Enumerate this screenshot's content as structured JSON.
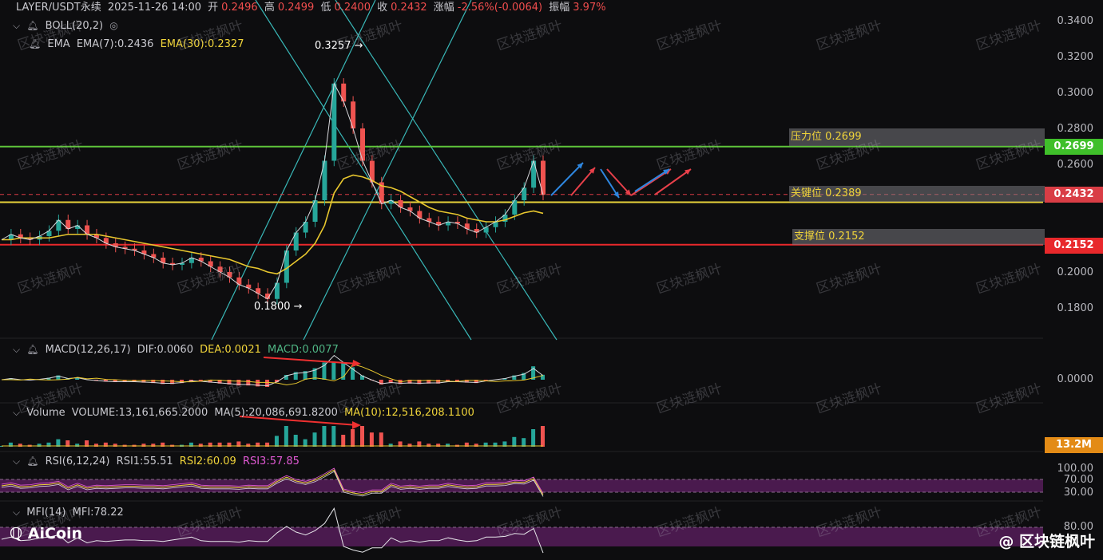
{
  "header": {
    "symbol": "LAYER/USDT永续",
    "datetime": "2025-11-26 14:00",
    "open_label": "开",
    "open": "0.2496",
    "high_label": "高",
    "high": "0.2499",
    "low_label": "低",
    "low": "0.2400",
    "close_label": "收",
    "close": "0.2432",
    "change_label": "涨幅",
    "change": "-2.56%(-0.0064)",
    "amp_label": "振幅",
    "amp": "3.97%"
  },
  "indicators": {
    "boll": "BOLL(20,2)",
    "ema_name": "EMA",
    "ema7": "EMA(7):0.2436",
    "ema30": "EMA(30):0.2327",
    "macd_name": "MACD(12,26,17)",
    "dif": "DIF:0.0060",
    "dea": "DEA:0.0021",
    "macd": "MACD:0.0077",
    "vol_name": "Volume",
    "vol": "VOLUME:13,161,665.2000",
    "ma5": "MA(5):20,086,691.8200",
    "ma10": "MA(10):12,516,208.1100",
    "rsi_name": "RSI(6,12,24)",
    "rsi1": "RSI1:55.51",
    "rsi2": "RSI2:60.09",
    "rsi3": "RSI3:57.85",
    "mfi_name": "MFI(14)",
    "mfi": "MFI:78.22"
  },
  "annotations": {
    "resistance": "压力位 0.2699",
    "key": "关键位 0.2389",
    "support": "支撑位 0.2152",
    "peak": "0.3257",
    "bottom": "0.1800"
  },
  "price_tags": {
    "resistance": "0.2699",
    "current": "0.2432",
    "support": "0.2152",
    "volume": "13.2M"
  },
  "price_axis": [
    "0.3400",
    "0.3200",
    "0.3000",
    "0.2800",
    "0.2600",
    "0.2000",
    "0.1800"
  ],
  "macd_axis": "0.0000",
  "rsi_axis": [
    "100.00",
    "70.00",
    "30.00"
  ],
  "mfi_axis": "80.00",
  "branding": {
    "logo": "AiCoin",
    "credit": "@ 区块链枫叶",
    "watermark": "区块涟枫叶"
  },
  "colors": {
    "resistance": "#5ec43a",
    "key": "#e8d23a",
    "support": "#e8282b",
    "up": "#26a69a",
    "down": "#ef5350"
  },
  "chart_data": {
    "type": "line",
    "title": "LAYER/USDT永续",
    "ylim": [
      0.17,
      0.345
    ],
    "levels": {
      "resistance": 0.2699,
      "key": 0.2389,
      "support": 0.2152,
      "current": 0.2432
    },
    "swing_high": 0.3257,
    "swing_low": 0.18,
    "price_series": [
      0.218,
      0.221,
      0.219,
      0.218,
      0.22,
      0.223,
      0.229,
      0.224,
      0.226,
      0.221,
      0.219,
      0.216,
      0.214,
      0.213,
      0.212,
      0.21,
      0.208,
      0.205,
      0.204,
      0.205,
      0.208,
      0.206,
      0.203,
      0.2,
      0.197,
      0.193,
      0.191,
      0.188,
      0.185,
      0.194,
      0.212,
      0.222,
      0.228,
      0.24,
      0.262,
      0.305,
      0.295,
      0.28,
      0.262,
      0.25,
      0.238,
      0.24,
      0.236,
      0.234,
      0.23,
      0.228,
      0.226,
      0.228,
      0.227,
      0.224,
      0.222,
      0.225,
      0.228,
      0.232,
      0.24,
      0.247,
      0.262,
      0.243
    ],
    "ema30_series": [
      0.218,
      0.218,
      0.219,
      0.219,
      0.219,
      0.219,
      0.22,
      0.221,
      0.221,
      0.221,
      0.221,
      0.22,
      0.219,
      0.218,
      0.217,
      0.216,
      0.215,
      0.214,
      0.213,
      0.212,
      0.211,
      0.21,
      0.209,
      0.208,
      0.207,
      0.205,
      0.203,
      0.202,
      0.2,
      0.199,
      0.202,
      0.206,
      0.21,
      0.216,
      0.226,
      0.244,
      0.252,
      0.254,
      0.253,
      0.251,
      0.248,
      0.247,
      0.245,
      0.242,
      0.239,
      0.236,
      0.234,
      0.233,
      0.232,
      0.23,
      0.229,
      0.228,
      0.228,
      0.229,
      0.231,
      0.233,
      0.234,
      0.2327
    ],
    "rsi_range": [
      0,
      100
    ],
    "mfi_value": 78.22
  }
}
